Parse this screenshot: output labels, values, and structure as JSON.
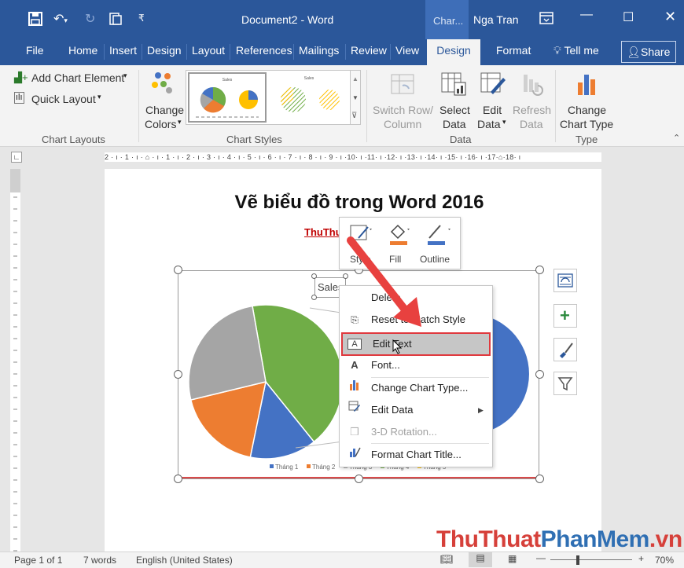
{
  "titlebar": {
    "document_title": "Document2  -  Word",
    "chart_tools": "Char...",
    "user": "Nga Tran"
  },
  "tabs": [
    {
      "label": "File"
    },
    {
      "label": "Home"
    },
    {
      "label": "Insert"
    },
    {
      "label": "Design"
    },
    {
      "label": "Layout"
    },
    {
      "label": "References"
    },
    {
      "label": "Mailings"
    },
    {
      "label": "Review"
    },
    {
      "label": "View"
    },
    {
      "label": "Design",
      "active": true
    },
    {
      "label": "Format"
    }
  ],
  "tell_me": "Tell me",
  "share": "Share",
  "ribbon": {
    "add_chart_element": "Add Chart Element",
    "quick_layout": "Quick Layout",
    "change_colors_1": "Change",
    "change_colors_2": "Colors",
    "group_chart_layouts": "Chart Layouts",
    "group_chart_styles": "Chart Styles",
    "switch_1": "Switch Row/",
    "switch_2": "Column",
    "select_1": "Select",
    "select_2": "Data",
    "edit_1": "Edit",
    "edit_2": "Data",
    "refresh_1": "Refresh",
    "refresh_2": "Data",
    "group_data": "Data",
    "change_type_1": "Change",
    "change_type_2": "Chart Type",
    "group_type": "Type"
  },
  "ruler_text": "2 · ı · 1 · ı · ⌂ · ı · 1 · ı · 2 · ı · 3 · ı · 4 · ı · 5 · ı · 6 · ı · 7 · ı · 8 · ı · 9 · ı ·10· ı ·11· ı ·12· ı ·13· ı ·14· ı ·15· ı ·16· ı ·17·⌂·18· ı",
  "document": {
    "title": "Vẽ biểu đồ trong Word 2016",
    "link": "ThuThu"
  },
  "chart": {
    "title_box": "Sales",
    "legend": [
      "Tháng 1",
      "Tháng 2",
      "Tháng 3",
      "Tháng 4",
      "Tháng 5"
    ]
  },
  "chart_data": {
    "type": "pie",
    "categories": [
      "Tháng 1",
      "Tháng 2",
      "Tháng 3",
      "Tháng 4",
      "Tháng 5"
    ],
    "values": [
      14,
      18,
      26,
      42,
      0
    ],
    "colors": [
      "#4472c4",
      "#ed7d31",
      "#a5a5a5",
      "#70ad47",
      "#ffc000"
    ],
    "title": "Sales",
    "legend": "bottom"
  },
  "mini_toolbar": {
    "style": "Style",
    "fill": "Fill",
    "outline": "Outline"
  },
  "context_menu": [
    {
      "label": "Delete",
      "icon": "delete-icon"
    },
    {
      "label": "Reset to Match Style",
      "icon": "reset-style-icon"
    },
    {
      "label": "Edit Text",
      "icon": "edit-text-icon",
      "highlighted": true
    },
    {
      "label": "Font...",
      "icon": "font-icon"
    },
    {
      "label": "Change Chart Type...",
      "icon": "chart-type-icon"
    },
    {
      "label": "Edit Data",
      "icon": "edit-data-icon",
      "submenu": true
    },
    {
      "label": "3-D Rotation...",
      "icon": "rotation-icon",
      "disabled": true
    },
    {
      "label": "Format Chart Title...",
      "icon": "format-title-icon"
    }
  ],
  "status": {
    "page": "Page 1 of 1",
    "words": "7 words",
    "language": "English (United States)",
    "zoom": "70%"
  },
  "watermark": {
    "part1": "ThuThuat",
    "part2": "PhanMem",
    "part3": ".vn"
  },
  "colors": {
    "brand": "#2b579a",
    "highlight_border": "#e0393e",
    "arrow": "#e8413f"
  }
}
